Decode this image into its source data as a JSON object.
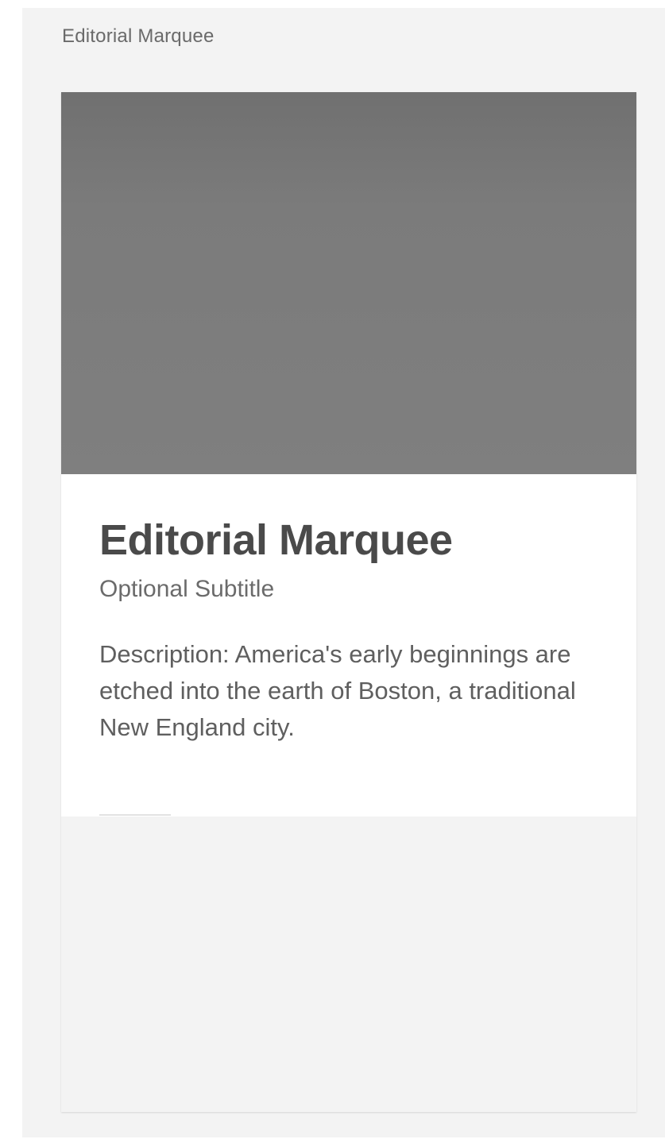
{
  "section": {
    "label": "Editorial Marquee"
  },
  "card": {
    "title": "Editorial Marquee",
    "subtitle": "Optional Subtitle",
    "description": "Description: America's early beginnings are etched into the earth of Boston, a traditional New England city."
  },
  "colors": {
    "page_background": "#f3f3f3",
    "image_placeholder": "#7f7f7f",
    "card_content_background": "#ffffff",
    "title_text": "#4a4a4a"
  }
}
